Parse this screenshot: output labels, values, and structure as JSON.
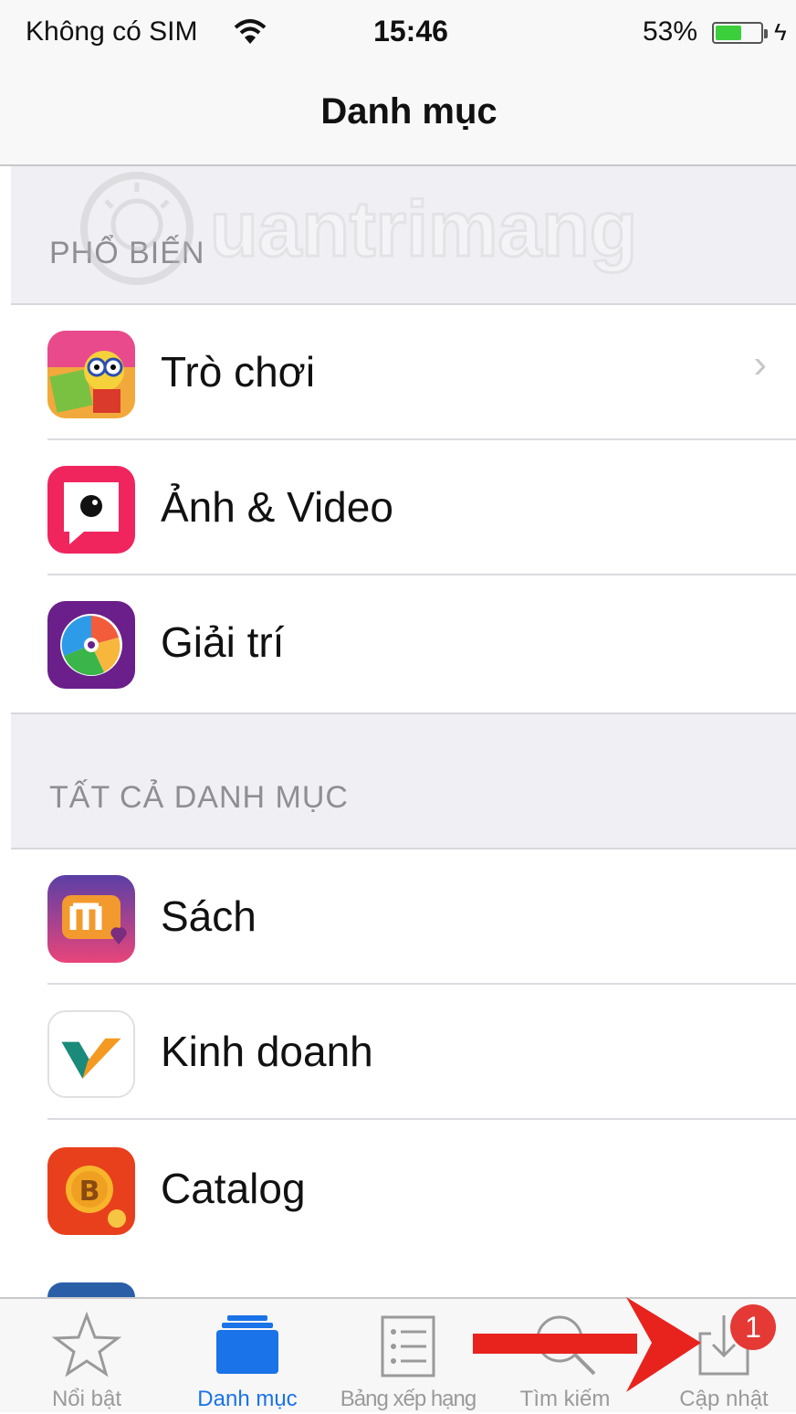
{
  "status_bar": {
    "carrier": "Không có SIM",
    "time": "15:46",
    "battery": "53%",
    "battery_level": 0.53
  },
  "nav": {
    "title": "Danh mục"
  },
  "watermark": "uantrimang",
  "sections": {
    "popular": "PHỔ BIẾN",
    "all": "TẤT CẢ DANH MỤC"
  },
  "rows": [
    {
      "label": "Trò chơi"
    },
    {
      "label": "Ảnh & Video"
    },
    {
      "label": "Giải trí"
    },
    {
      "label": "Sách"
    },
    {
      "label": "Kinh doanh"
    },
    {
      "label": "Catalog"
    }
  ],
  "tabs": [
    {
      "label": "Nổi bật",
      "icon": "star-icon"
    },
    {
      "label": "Danh mục",
      "icon": "categories-icon",
      "active": true
    },
    {
      "label": "Bảng xếp hạng",
      "icon": "list-icon"
    },
    {
      "label": "Tìm kiếm",
      "icon": "search-icon"
    },
    {
      "label": "Cập nhật",
      "icon": "download-icon",
      "badge": "1"
    }
  ],
  "colors": {
    "accent": "#1a73e8",
    "badge": "#e53935",
    "annotation_arrow": "#e8231e"
  }
}
